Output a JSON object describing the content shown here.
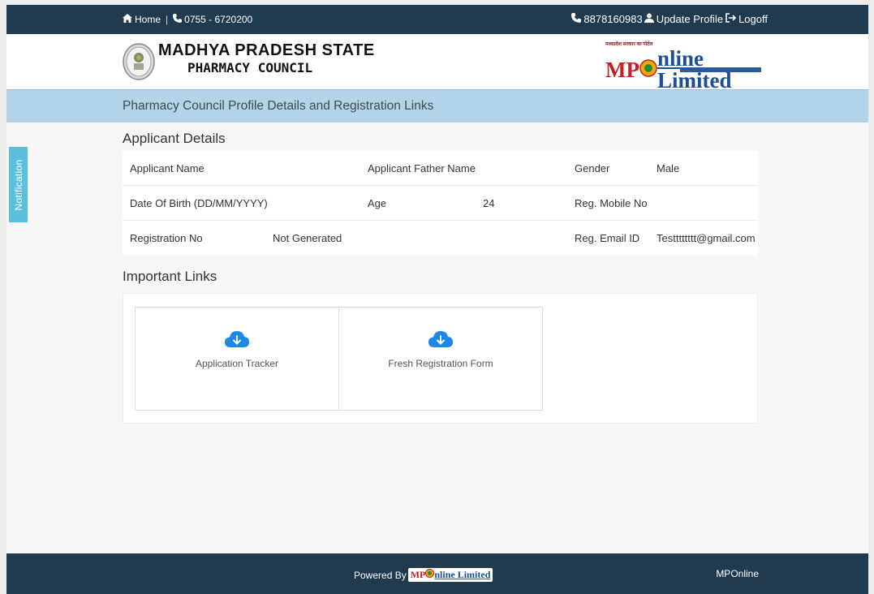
{
  "topbar": {
    "home_label": "Home",
    "phone_label": "0755 - 6720200",
    "helpline": "8878160983",
    "update_profile_label": "Update Profile",
    "logoff_label": "Logoff"
  },
  "header": {
    "council_line1": "MADHYA PRADESH STATE",
    "council_line2": "PHARMACY COUNCIL",
    "mp_logo_tag": "मध्यप्रदेश सरकार का पोर्टल",
    "mp_logo_text_1": "MP",
    "mp_logo_text_2": "nline Limited"
  },
  "page_title": "Pharmacy Council Profile Details and Registration Links",
  "applicant": {
    "section_title": "Applicant Details",
    "rows": [
      {
        "l1": "Applicant Name",
        "v1": "",
        "l2": "Applicant Father Name",
        "v2": "",
        "l3": "Gender",
        "v3": "Male"
      },
      {
        "l1": "Date Of Birth (DD/MM/YYYY)",
        "v1": "",
        "l2": "Age",
        "v2": "24",
        "l3": "Reg. Mobile No",
        "v3": ""
      },
      {
        "l1": "Registration No",
        "v1": "Not Generated",
        "l2": "",
        "v2": "",
        "l3": "Reg. Email ID",
        "v3": "Testttttttt@gmail.com"
      }
    ]
  },
  "links": {
    "section_title": "Important Links",
    "items": [
      {
        "label": "Application Tracker",
        "icon": "cloud-download-icon"
      },
      {
        "label": "Fresh Registration Form",
        "icon": "cloud-download-icon"
      }
    ]
  },
  "notification_label": "Notification",
  "footer": {
    "powered_by": "Powered By",
    "powered_logo_1": "MP",
    "powered_logo_2": "nline Limited",
    "right_text": "MPOnline"
  },
  "colors": {
    "topbar_bg": "#203a4f",
    "title_band_bg": "#b3d3e8",
    "notification_bg": "#5bc0de",
    "download_icon": "#1e88e5"
  }
}
